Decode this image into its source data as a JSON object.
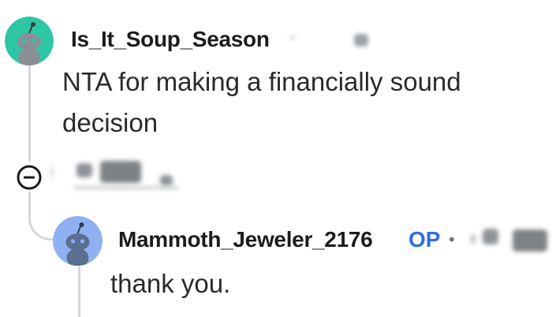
{
  "comments": [
    {
      "username": "Is_It_Soup_Season",
      "avatar_color": "#2ec7a5",
      "body": [
        "NTA for making a financially sound",
        "decision"
      ]
    },
    {
      "username": "Mammoth_Jeweler_2176",
      "op_badge": "OP",
      "separator": "•",
      "avatar_color": "#8fb1f2",
      "body": [
        "thank you."
      ]
    }
  ],
  "colors": {
    "op_badge": "#2e6fe0",
    "thread_line": "#d4d7d9",
    "text": "#1a1a1b"
  },
  "icons": {
    "collapse": "minus-circle-icon",
    "avatar": "reddit-snoo-icon"
  }
}
